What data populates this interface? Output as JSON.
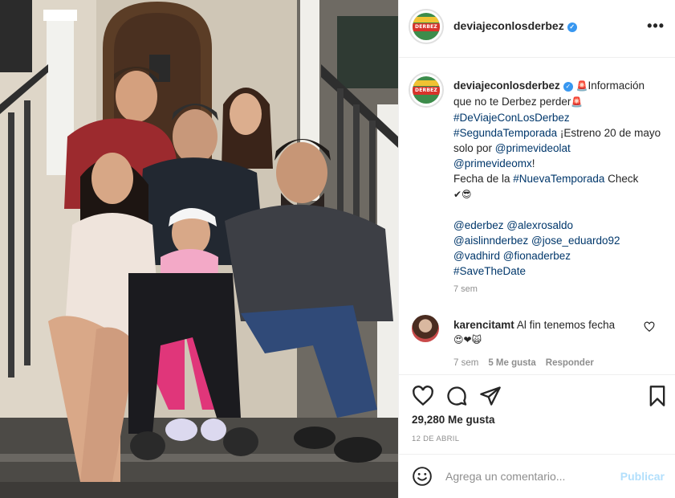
{
  "post": {
    "username": "deviajeconlosderbez",
    "verified_icon": "verified-badge-icon",
    "more_icon": "more-options-icon",
    "more_label": "•••"
  },
  "caption": {
    "username": "deviajeconlosderbez",
    "text_1": "Información que no te Derbez perder",
    "emoji_1": "🚨",
    "emoji_2": "🚨",
    "hashtag_1": "#DeViajeConLosDerbez",
    "hashtag_2": "#SegundaTemporada",
    "text_2": " ¡Estreno 20 de mayo solo por ",
    "mention_1": "@primevideolat",
    "mention_2": "@primevideomx",
    "text_3": "!",
    "text_4": "Fecha de la ",
    "hashtag_3": "#NuevaTemporada",
    "text_5": " Check",
    "emoji_3": "✔😎",
    "mention_3": "@ederbez",
    "mention_4": "@alexrosaldo",
    "mention_5": "@aislinnderbez",
    "mention_6": "@jose_eduardo92",
    "mention_7": "@vadhird",
    "mention_8": "@fionaderbez",
    "hashtag_4": "#SaveTheDate",
    "time": "7 sem"
  },
  "comment": {
    "username": "karencitamt",
    "text": "Al fin tenemos fecha",
    "emojis": "😍❤🙀",
    "time": "7 sem",
    "likes": "5 Me gusta",
    "reply": "Responder"
  },
  "actions": {
    "likes": "29,280 Me gusta",
    "date": "12 DE ABRIL",
    "icons": [
      "heart-icon",
      "comment-icon",
      "share-icon",
      "bookmark-icon"
    ]
  },
  "add_comment": {
    "placeholder": "Agrega un comentario...",
    "publish": "Publicar"
  },
  "colors": {
    "link": "#00376b",
    "verified": "#3897f0",
    "publish_disabled": "#b2dffc",
    "muted": "#8e8e8e"
  }
}
